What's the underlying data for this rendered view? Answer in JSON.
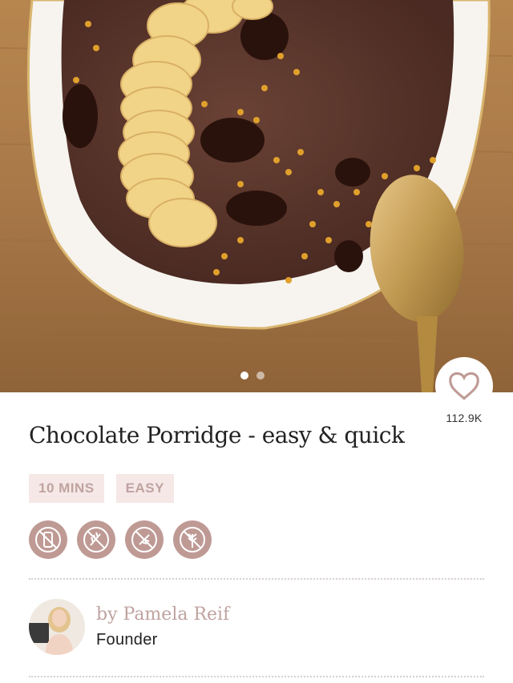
{
  "hero": {
    "image_alt": "Chocolate porridge bowl with banana slices, chocolate chunks and bee pollen",
    "carousel_pages": 2,
    "carousel_active": 1
  },
  "like": {
    "count": "112.9K",
    "icon": "heart-outline-icon"
  },
  "recipe": {
    "title": "Chocolate Porridge - easy & quick",
    "tags": [
      "10 MINS",
      "EASY"
    ],
    "diet_icons": [
      "lactose-free-icon",
      "gluten-free-icon",
      "gluten-free-icon-2",
      "wheat-free-icon"
    ]
  },
  "author": {
    "name": "by Pamela Reif",
    "role": "Founder"
  },
  "colors": {
    "accent": "#bf9a95",
    "tag_bg": "#f5e8e6",
    "tag_text": "#bfa3a0"
  }
}
